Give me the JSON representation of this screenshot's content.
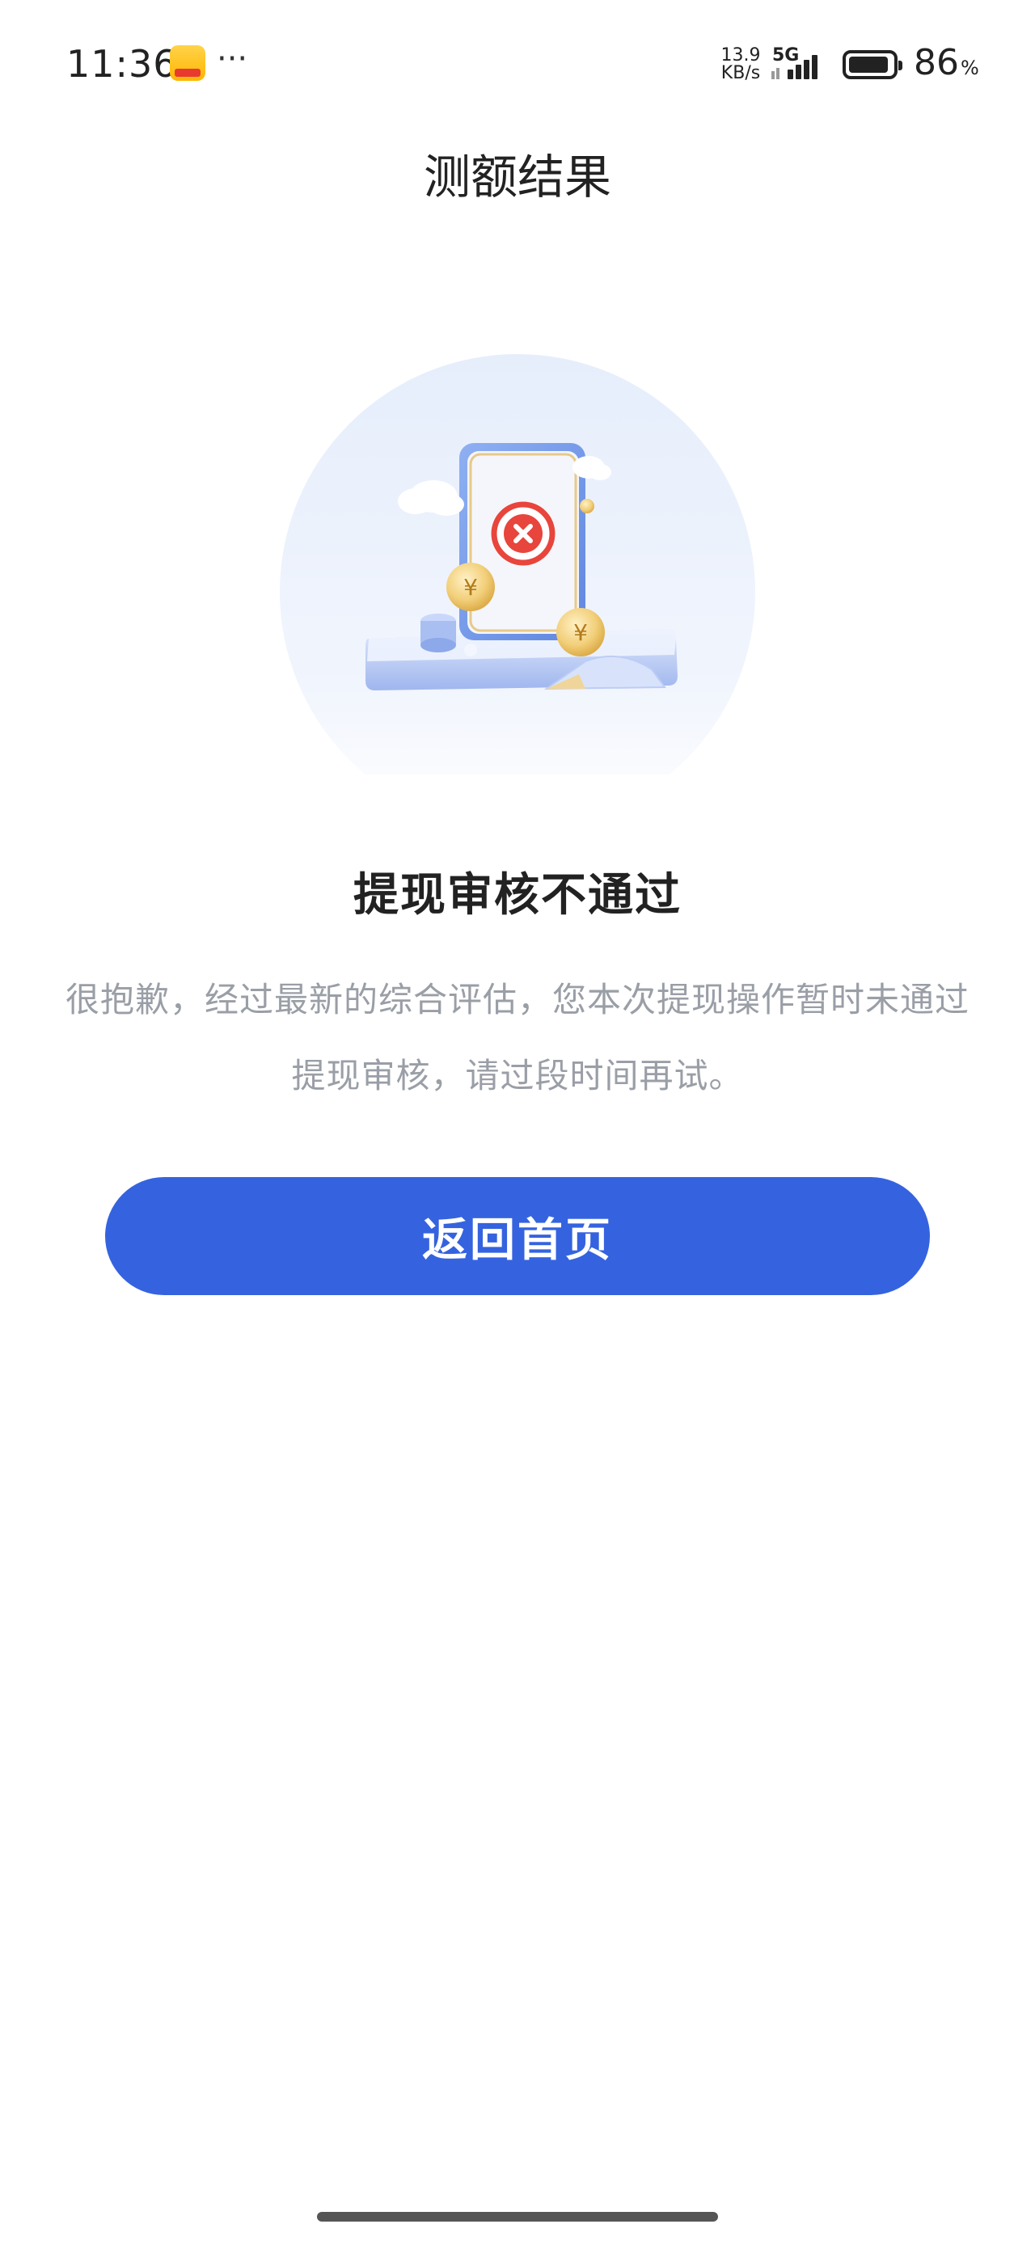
{
  "status_bar": {
    "time": "11:36",
    "more": "···",
    "net_speed_value": "13.9",
    "net_speed_unit": "KB/s",
    "net_type": "5G",
    "battery_level": "86",
    "battery_unit": "%",
    "icons": [
      "app-notification-icon",
      "signal-icon",
      "battery-icon"
    ]
  },
  "header": {
    "title": "测额结果"
  },
  "illustration": {
    "icon": "rejected-withdrawal-illustration",
    "accent_color": "#e8453c"
  },
  "result": {
    "title": "提现审核不通过",
    "description": "很抱歉，经过最新的综合评估，您本次提现操作暂时未通过提现审核，请过段时间再试。"
  },
  "actions": {
    "home_button_label": "返回首页",
    "home_button_color": "#3563df"
  }
}
